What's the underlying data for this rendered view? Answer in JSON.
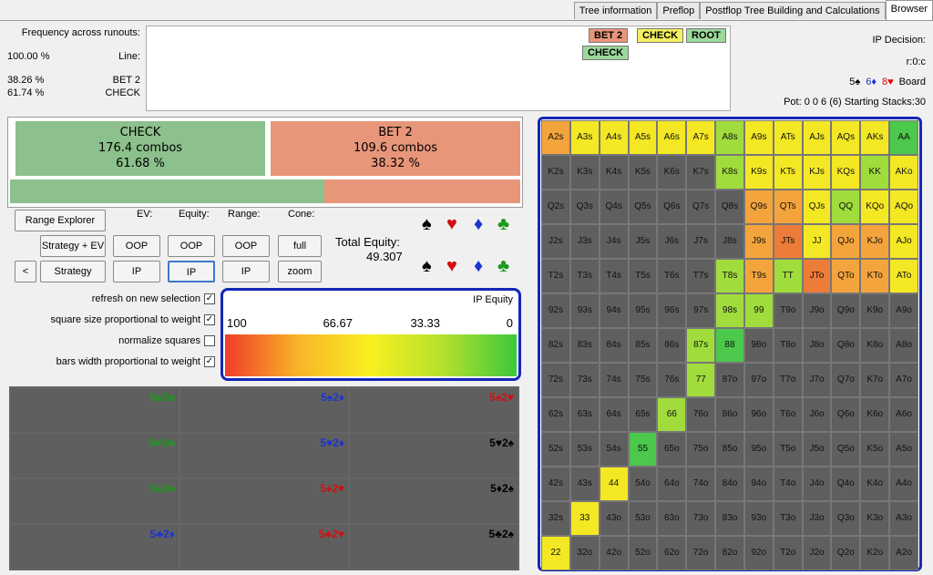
{
  "tabs": [
    "Browser",
    "Postflop Tree Building and Calculations",
    "Preflop",
    "Tree information"
  ],
  "info": {
    "decision": "IP Decision:",
    "path": "r:0:c",
    "board_label": "Board",
    "board_cards": [
      "8♥",
      "6♦",
      "5♠"
    ],
    "pot": "Pot: 0 0 6 (6) Starting Stacks:30"
  },
  "tree": {
    "root": "ROOT",
    "check": "CHECK",
    "bet": "BET 2",
    "check2": "CHECK"
  },
  "freq": {
    "title": "Frequency across runouts:",
    "line_label": "Line:",
    "line_value": "100.00 %",
    "bet_label": "BET 2",
    "bet_value": "38.26 %",
    "check_label": "CHECK",
    "check_value": "61.74 %"
  },
  "strategy": {
    "bet": {
      "name": "BET 2",
      "combos": "109.6 combos",
      "pct": "38.32 %",
      "color": "#e8967a"
    },
    "check": {
      "name": "CHECK",
      "combos": "176.4 combos",
      "pct": "61.68 %",
      "color": "#8cc08c"
    }
  },
  "controls": {
    "cone": "Cone:",
    "range": "Range:",
    "equity": "Equity:",
    "ev": "EV:",
    "total_equity_label": "Total Equity:",
    "total_equity_value": "49.307",
    "full": "full",
    "zoom": "zoom",
    "oop1": "OOP",
    "ip1": "IP",
    "oop2": "OOP",
    "ip2": "IP",
    "oop3": "OOP",
    "ip3": "IP",
    "range_explorer": "Range Explorer",
    "strategy_ev": "Strategy + EV",
    "strategy": "Strategy",
    "back": "<"
  },
  "options": {
    "refresh": "refresh on new selection",
    "square_size": "square size proportional to weight",
    "normalize": "normalize squares",
    "bars_width": "bars width proportional to weight"
  },
  "equity_legend": {
    "title": "IP Equity",
    "ticks": [
      "0",
      "33.33",
      "66.67",
      "100"
    ]
  },
  "combos": [
    [
      "5♠2♥",
      "5♠2♦",
      "5♠2♣"
    ],
    [
      "5♥2♠",
      "5♥2♦",
      "5♥2♣"
    ],
    [
      "5♦2♠",
      "5♦2♥",
      "5♦2♣"
    ],
    [
      "5♣2♠",
      "5♣2♥",
      "5♣2♦"
    ]
  ],
  "matrix_rows": [
    [
      "AA",
      "AKs",
      "AQs",
      "AJs",
      "ATs",
      "A9s",
      "A8s",
      "A7s",
      "A6s",
      "A5s",
      "A4s",
      "A3s",
      "A2s"
    ],
    [
      "AKo",
      "KK",
      "KQs",
      "KJs",
      "KTs",
      "K9s",
      "K8s",
      "K7s",
      "K6s",
      "K5s",
      "K4s",
      "K3s",
      "K2s"
    ],
    [
      "AQo",
      "KQo",
      "QQ",
      "QJs",
      "QTs",
      "Q9s",
      "Q8s",
      "Q7s",
      "Q6s",
      "Q5s",
      "Q4s",
      "Q3s",
      "Q2s"
    ],
    [
      "AJo",
      "KJo",
      "QJo",
      "JJ",
      "JTs",
      "J9s",
      "J8s",
      "J7s",
      "J6s",
      "J5s",
      "J4s",
      "J3s",
      "J2s"
    ],
    [
      "ATo",
      "KTo",
      "QTo",
      "JTo",
      "TT",
      "T9s",
      "T8s",
      "T7s",
      "T6s",
      "T5s",
      "T4s",
      "T3s",
      "T2s"
    ],
    [
      "A9o",
      "K9o",
      "Q9o",
      "J9o",
      "T9o",
      "99",
      "98s",
      "97s",
      "96s",
      "95s",
      "94s",
      "93s",
      "92s"
    ],
    [
      "A8o",
      "K8o",
      "Q8o",
      "J8o",
      "T8o",
      "98o",
      "88",
      "87s",
      "86s",
      "85s",
      "84s",
      "83s",
      "82s"
    ],
    [
      "A7o",
      "K7o",
      "Q7o",
      "J7o",
      "T7o",
      "97o",
      "87o",
      "77",
      "76s",
      "75s",
      "74s",
      "73s",
      "72s"
    ],
    [
      "A6o",
      "K6o",
      "Q6o",
      "J6o",
      "T6o",
      "96o",
      "86o",
      "76o",
      "66",
      "65s",
      "64s",
      "63s",
      "62s"
    ],
    [
      "A5o",
      "K5o",
      "Q5o",
      "J5o",
      "T5o",
      "95o",
      "85o",
      "75o",
      "65o",
      "55",
      "54s",
      "53s",
      "52s"
    ],
    [
      "A4o",
      "K4o",
      "Q4o",
      "J4o",
      "T4o",
      "94o",
      "84o",
      "74o",
      "64o",
      "54o",
      "44",
      "43s",
      "42s"
    ],
    [
      "A3o",
      "K3o",
      "Q3o",
      "J3o",
      "T3o",
      "93o",
      "83o",
      "73o",
      "63o",
      "53o",
      "43o",
      "33",
      "32s"
    ],
    [
      "A2o",
      "K2o",
      "Q2o",
      "J2o",
      "T2o",
      "92o",
      "82o",
      "72o",
      "62o",
      "52o",
      "42o",
      "32o",
      "22"
    ]
  ],
  "colors": {
    "green": "#4cc84c",
    "lightgreen": "#a0dc3c",
    "yellow": "#f4e824",
    "orange": "#f4a43c",
    "orangered": "#ec7c38",
    "gray": "#5f5f5f",
    "blue_border": "#1428b4"
  }
}
